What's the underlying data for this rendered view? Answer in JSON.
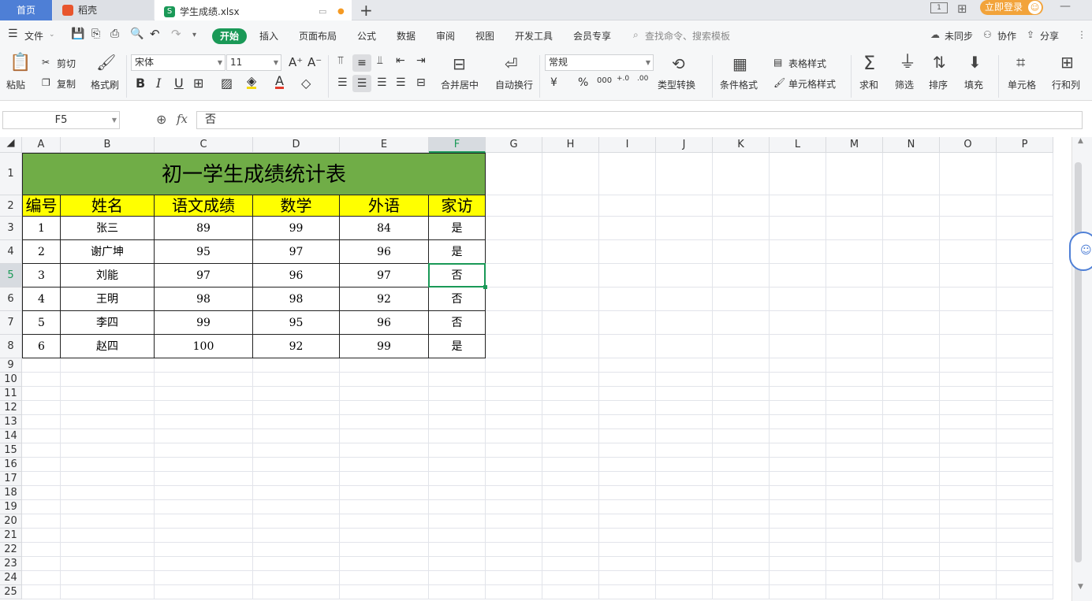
{
  "tabs": {
    "home": "首页",
    "daoke": "稻壳",
    "file": "学生成绩.xlsx",
    "login": "立即登录"
  },
  "menu": {
    "file": "文件",
    "items": [
      "开始",
      "插入",
      "页面布局",
      "公式",
      "数据",
      "审阅",
      "视图",
      "开发工具",
      "会员专享"
    ],
    "search": "查找命令、搜索模板",
    "sync": "未同步",
    "collab": "协作",
    "share": "分享"
  },
  "ribbon": {
    "paste": "粘贴",
    "cut": "剪切",
    "copy": "复制",
    "format_painter": "格式刷",
    "font": "宋体",
    "font_size": "11",
    "merge": "合并居中",
    "wrap": "自动换行",
    "number_format": "常规",
    "type_convert": "类型转换",
    "cond_format": "条件格式",
    "table_style": "表格样式",
    "cell_style": "单元格样式",
    "sum": "求和",
    "filter": "筛选",
    "sort": "排序",
    "fill": "填充",
    "cell": "单元格",
    "rowcol": "行和列"
  },
  "formula": {
    "name_box": "F5",
    "fx": "fx",
    "value": "否"
  },
  "columns": [
    "A",
    "B",
    "C",
    "D",
    "E",
    "F",
    "G",
    "H",
    "I",
    "J",
    "K",
    "L",
    "M",
    "N",
    "O",
    "P"
  ],
  "rows": [
    "1",
    "2",
    "3",
    "4",
    "5",
    "6",
    "7",
    "8",
    "9",
    "10",
    "11",
    "12",
    "13",
    "14",
    "15",
    "16",
    "17",
    "18",
    "19",
    "20",
    "21",
    "22",
    "23",
    "24",
    "25"
  ],
  "sheet": {
    "title": "初一学生成绩统计表",
    "headers": [
      "编号",
      "姓名",
      "语文成绩",
      "数学",
      "外语",
      "家访"
    ],
    "data": [
      [
        "1",
        "张三",
        "89",
        "99",
        "84",
        "是"
      ],
      [
        "2",
        "谢广坤",
        "95",
        "97",
        "96",
        "是"
      ],
      [
        "3",
        "刘能",
        "97",
        "96",
        "97",
        "否"
      ],
      [
        "4",
        "王明",
        "98",
        "98",
        "92",
        "否"
      ],
      [
        "5",
        "李四",
        "99",
        "95",
        "96",
        "否"
      ],
      [
        "6",
        "赵四",
        "100",
        "92",
        "99",
        "是"
      ]
    ]
  },
  "colors": {
    "title_bg": "#70ad47",
    "header_bg": "#ffff00",
    "accent": "#1a9957",
    "tab_blue": "#4e7fd6"
  }
}
